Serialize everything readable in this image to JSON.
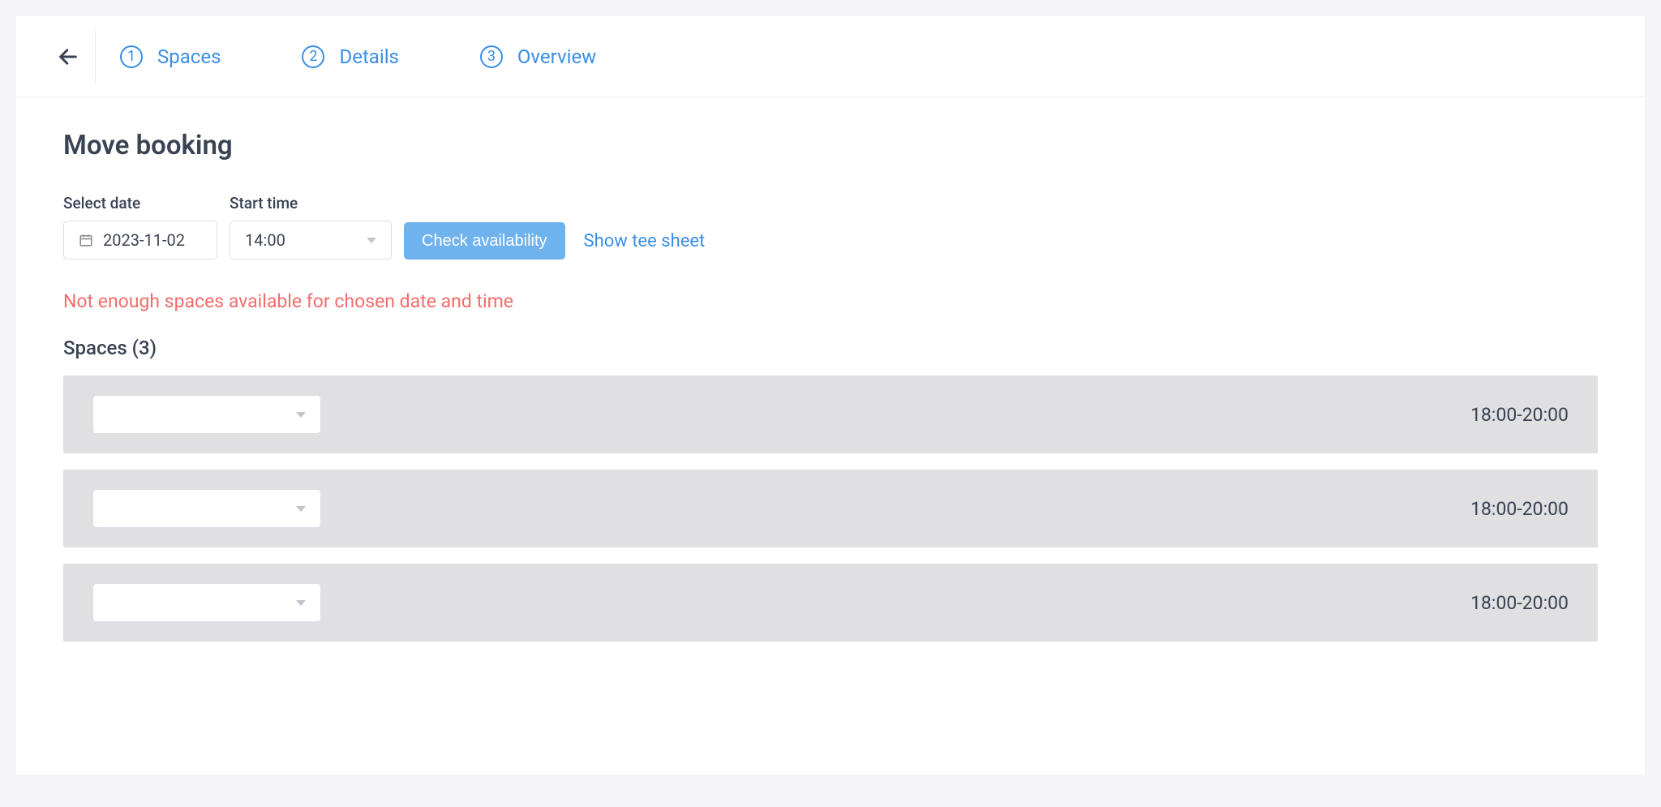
{
  "steps": [
    {
      "num": "1",
      "label": "Spaces"
    },
    {
      "num": "2",
      "label": "Details"
    },
    {
      "num": "3",
      "label": "Overview"
    }
  ],
  "page_title": "Move booking",
  "form": {
    "date_label": "Select date",
    "date_value": "2023-11-02",
    "time_label": "Start time",
    "time_value": "14:00",
    "check_button": "Check availability",
    "tee_link": "Show tee sheet"
  },
  "error_message": "Not enough spaces available for chosen date and time",
  "spaces": {
    "heading": "Spaces (3)",
    "rows": [
      {
        "selected": "",
        "time": "18:00-20:00"
      },
      {
        "selected": "",
        "time": "18:00-20:00"
      },
      {
        "selected": "",
        "time": "18:00-20:00"
      }
    ]
  }
}
